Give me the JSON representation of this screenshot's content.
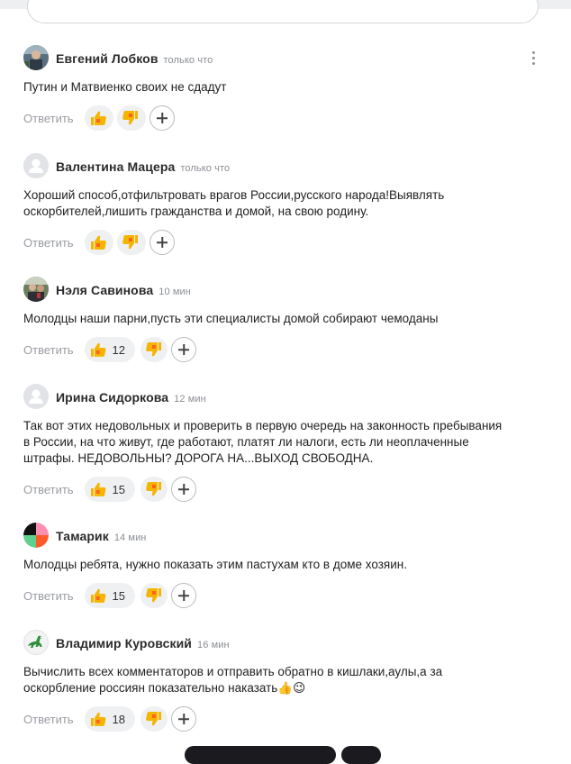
{
  "reply_label": "Ответить",
  "colors": {
    "accent_like": "#f5b400",
    "like_inner": "#ff5a1f",
    "dislike_inner": "#ff5a1f",
    "pill_bg": "#eff0f2",
    "muted": "#9a9ca2"
  },
  "icons": {
    "like": "thumbs-up-icon",
    "dislike": "thumbs-down-icon",
    "add": "plus-icon",
    "menu": "more-vertical-icon",
    "default_avatar": "user-placeholder-icon"
  },
  "comments": [
    {
      "author": "Евгений Лобков",
      "time": "только что",
      "text": "Путин и Матвиенко своих не сдадут",
      "likes": ""
    },
    {
      "author": "Валентина Мацера",
      "time": "только что",
      "text": "Хороший способ,отфильтровать врагов России,русского народа!Выявлять\nоскорбителей,лишить гражданства и домой, на свою родину.",
      "likes": ""
    },
    {
      "author": "Нэля Савинова",
      "time": "10 мин",
      "text": "Молодцы наши парни,пусть эти специалисты домой собирают чемоданы",
      "likes": "12"
    },
    {
      "author": "Ирина Сидоркова",
      "time": "12 мин",
      "text": "Так вот этих недовольных и проверить в первую очередь на законность пребывания\nв России, на что живут, где работают, платят ли налоги, есть ли неоплаченные\nштрафы. НЕДОВОЛЬНЫ? ДОРОГА НА...ВЫХОД СВОБОДНА.",
      "likes": "15"
    },
    {
      "author": "Тамарик",
      "time": "14 мин",
      "text": "Молодцы ребята, нужно показать этим пастухам кто в доме хозяин.",
      "likes": "15"
    },
    {
      "author": "Владимир Куровский",
      "time": "16 мин",
      "text": "Вычислить всех комментаторов и отправить обратно в кишлаки,аулы,а за\nоскорбление россиян показательно наказать👍😉",
      "likes": "18"
    }
  ]
}
